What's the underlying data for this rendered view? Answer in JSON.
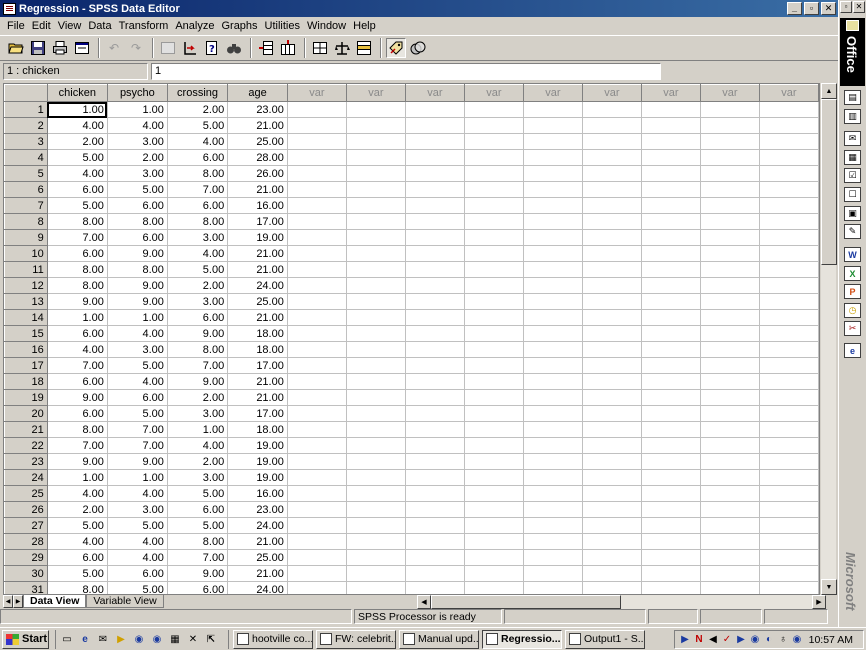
{
  "window": {
    "title": "Regression - SPSS Data Editor"
  },
  "menu": [
    "File",
    "Edit",
    "View",
    "Data",
    "Transform",
    "Analyze",
    "Graphs",
    "Utilities",
    "Window",
    "Help"
  ],
  "cell_editor": {
    "reference": "1 : chicken",
    "value": "1"
  },
  "grid": {
    "columns": [
      "chicken",
      "psycho",
      "crossing",
      "age",
      "var",
      "var",
      "var",
      "var",
      "var",
      "var",
      "var",
      "var",
      "var"
    ],
    "rows": [
      [
        "1",
        "1.00",
        "1.00",
        "2.00",
        "23.00"
      ],
      [
        "2",
        "4.00",
        "4.00",
        "5.00",
        "21.00"
      ],
      [
        "3",
        "2.00",
        "3.00",
        "4.00",
        "25.00"
      ],
      [
        "4",
        "5.00",
        "2.00",
        "6.00",
        "28.00"
      ],
      [
        "5",
        "4.00",
        "3.00",
        "8.00",
        "26.00"
      ],
      [
        "6",
        "6.00",
        "5.00",
        "7.00",
        "21.00"
      ],
      [
        "7",
        "5.00",
        "6.00",
        "6.00",
        "16.00"
      ],
      [
        "8",
        "8.00",
        "8.00",
        "8.00",
        "17.00"
      ],
      [
        "9",
        "7.00",
        "6.00",
        "3.00",
        "19.00"
      ],
      [
        "10",
        "6.00",
        "9.00",
        "4.00",
        "21.00"
      ],
      [
        "11",
        "8.00",
        "8.00",
        "5.00",
        "21.00"
      ],
      [
        "12",
        "8.00",
        "9.00",
        "2.00",
        "24.00"
      ],
      [
        "13",
        "9.00",
        "9.00",
        "3.00",
        "25.00"
      ],
      [
        "14",
        "1.00",
        "1.00",
        "6.00",
        "21.00"
      ],
      [
        "15",
        "6.00",
        "4.00",
        "9.00",
        "18.00"
      ],
      [
        "16",
        "4.00",
        "3.00",
        "8.00",
        "18.00"
      ],
      [
        "17",
        "7.00",
        "5.00",
        "7.00",
        "17.00"
      ],
      [
        "18",
        "6.00",
        "4.00",
        "9.00",
        "21.00"
      ],
      [
        "19",
        "9.00",
        "6.00",
        "2.00",
        "21.00"
      ],
      [
        "20",
        "6.00",
        "5.00",
        "3.00",
        "17.00"
      ],
      [
        "21",
        "8.00",
        "7.00",
        "1.00",
        "18.00"
      ],
      [
        "22",
        "7.00",
        "7.00",
        "4.00",
        "19.00"
      ],
      [
        "23",
        "9.00",
        "9.00",
        "2.00",
        "19.00"
      ],
      [
        "24",
        "1.00",
        "1.00",
        "3.00",
        "19.00"
      ],
      [
        "25",
        "4.00",
        "4.00",
        "5.00",
        "16.00"
      ],
      [
        "26",
        "2.00",
        "3.00",
        "6.00",
        "23.00"
      ],
      [
        "27",
        "5.00",
        "5.00",
        "5.00",
        "24.00"
      ],
      [
        "28",
        "4.00",
        "4.00",
        "8.00",
        "21.00"
      ],
      [
        "29",
        "6.00",
        "4.00",
        "7.00",
        "25.00"
      ],
      [
        "30",
        "5.00",
        "6.00",
        "9.00",
        "21.00"
      ],
      [
        "31",
        "8.00",
        "5.00",
        "6.00",
        "24.00"
      ]
    ]
  },
  "tabs": [
    "Data View",
    "Variable View"
  ],
  "status": {
    "processor": "SPSS Processor  is ready"
  },
  "office_bar": {
    "brand": "Office",
    "footer": "Microsoft"
  },
  "taskbar": {
    "start": "Start",
    "tasks": [
      "hootville co...",
      "FW: celebrit...",
      "Manual upd...",
      "Regressio...",
      "Output1 - S..."
    ],
    "clock": "10:57 AM"
  }
}
